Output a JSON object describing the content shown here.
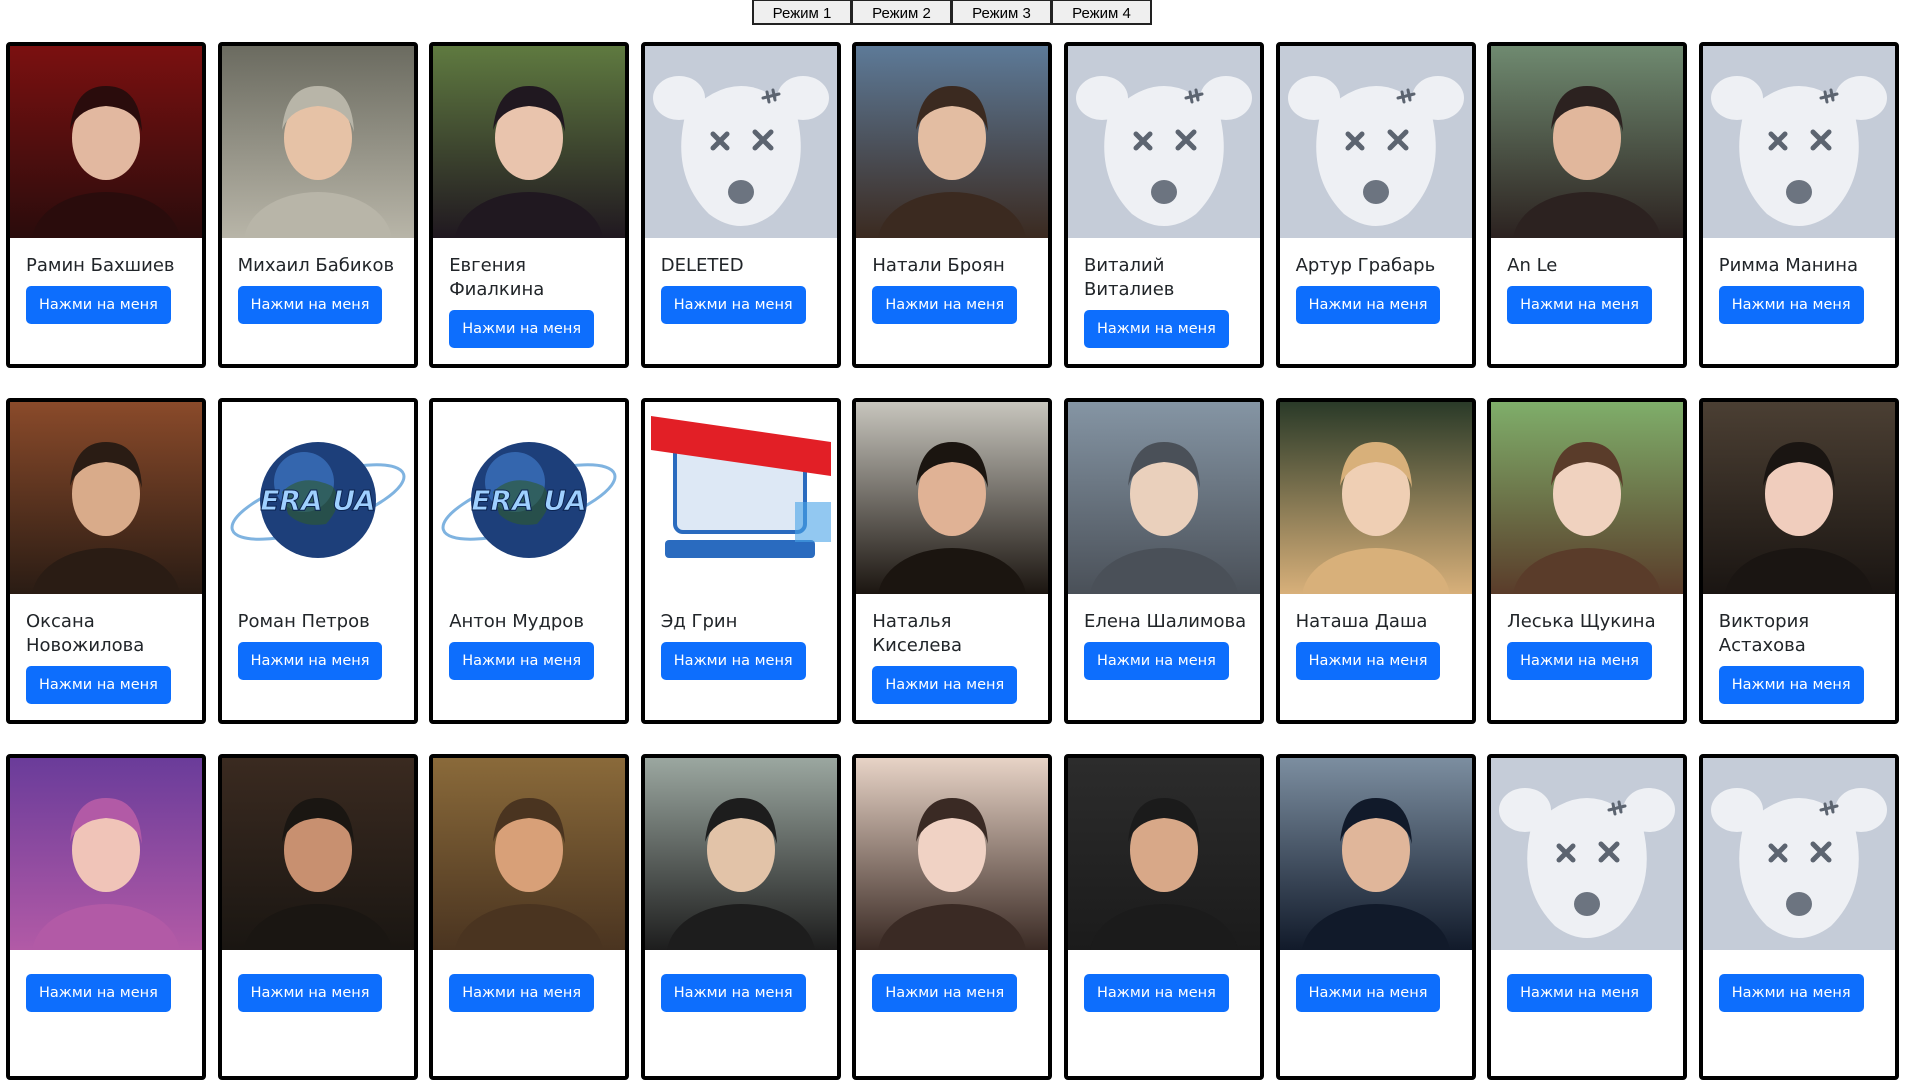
{
  "modes": [
    "Режим 1",
    "Режим 2",
    "Режим 3",
    "Режим 4"
  ],
  "button_label": "Нажми на меня",
  "cards": [
    {
      "name": "Рамин Бахшиев",
      "photo": "photo-dark-red"
    },
    {
      "name": "Михаил Бабиков",
      "photo": "photo-man-hoodie"
    },
    {
      "name": "Евгения Фиалкина",
      "photo": "photo-woman-dark-hair"
    },
    {
      "name": "DELETED",
      "photo": "deleted-dog-avatar"
    },
    {
      "name": "Натали Броян",
      "photo": "photo-woman-cap"
    },
    {
      "name": "Виталий Виталиев",
      "photo": "deleted-dog-avatar"
    },
    {
      "name": "Артур Грабарь",
      "photo": "deleted-dog-avatar"
    },
    {
      "name": "An Le",
      "photo": "photo-woman-sunglasses"
    },
    {
      "name": "Римма Манина",
      "photo": "deleted-dog-avatar"
    },
    {
      "name": "Оксана Новожилова",
      "photo": "photo-woman-brick"
    },
    {
      "name": "Роман Петров",
      "photo": "globe-logo"
    },
    {
      "name": "Антон Мудров",
      "photo": "globe-logo"
    },
    {
      "name": "Эд Грин",
      "photo": "service-logo"
    },
    {
      "name": "Наталья Киселева",
      "photo": "photo-woman-green"
    },
    {
      "name": "Елена Шалимова",
      "photo": "photo-man-river"
    },
    {
      "name": "Наташа Даша",
      "photo": "photo-woman-blonde"
    },
    {
      "name": "Леська Щукина",
      "photo": "photo-woman-park"
    },
    {
      "name": "Виктория Астахова",
      "photo": "photo-woman-room"
    },
    {
      "name": "",
      "photo": "photo-two-girls"
    },
    {
      "name": "",
      "photo": "photo-man-sunset"
    },
    {
      "name": "",
      "photo": "photo-woman-blur"
    },
    {
      "name": "",
      "photo": "photo-man-road"
    },
    {
      "name": "",
      "photo": "photo-woman-closeup"
    },
    {
      "name": "",
      "photo": "photo-man-cap-glasses"
    },
    {
      "name": "",
      "photo": "photo-man-polo"
    },
    {
      "name": "",
      "photo": "deleted-dog-avatar"
    },
    {
      "name": "",
      "photo": "deleted-dog-avatar"
    }
  ],
  "colors": {
    "button": "#0d6efd",
    "deleted_bg": "#c5ccd8",
    "card_border": "#000000"
  }
}
